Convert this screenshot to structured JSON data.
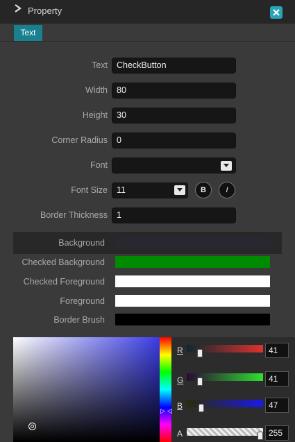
{
  "panel": {
    "title": "Property",
    "active_tab": "Text"
  },
  "properties": [
    {
      "label": "Text",
      "value": "CheckButton"
    },
    {
      "label": "Width",
      "value": "80"
    },
    {
      "label": "Height",
      "value": "30"
    },
    {
      "label": "Corner Radius",
      "value": "0"
    },
    {
      "label": "Font",
      "value": ""
    },
    {
      "label": "Font Size",
      "value": "11"
    },
    {
      "label": "Border Thickness",
      "value": "1"
    }
  ],
  "style_buttons": {
    "bold": "B",
    "italic": "I"
  },
  "brushes": [
    {
      "label": "Background",
      "color": "#282828"
    },
    {
      "label": "Checked Background",
      "color": "#008a00"
    },
    {
      "label": "Checked Foreground",
      "color": "#ffffff"
    },
    {
      "label": "Foreground",
      "color": "#ffffff"
    },
    {
      "label": "Border Brush",
      "color": "#000000"
    }
  ],
  "color_picker": {
    "channels": [
      {
        "label": "R",
        "value": "41"
      },
      {
        "label": "G",
        "value": "41"
      },
      {
        "label": "B",
        "value": "47"
      },
      {
        "label": "A",
        "value": "255"
      }
    ],
    "colors": {
      "accent": "#19808f"
    }
  }
}
